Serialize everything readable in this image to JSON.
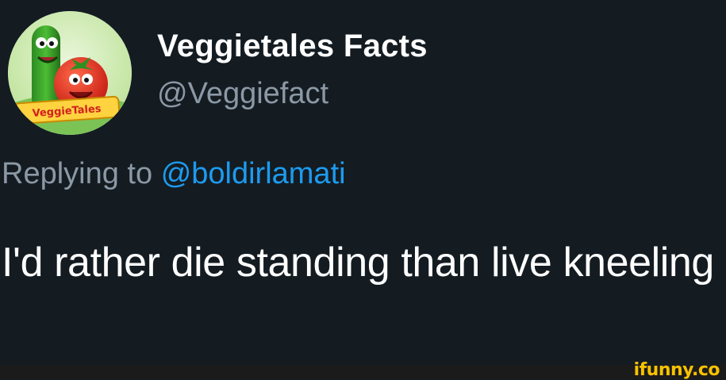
{
  "account": {
    "display_name": "Veggietales Facts",
    "handle": "@Veggiefact",
    "avatar_logo_text": "VeggieTales"
  },
  "reply": {
    "prefix": "Replying to",
    "mention": "@boldirlamati"
  },
  "tweet": {
    "text": "I'd rather die standing than live kneeling"
  },
  "watermark": {
    "text": "ifunny.co"
  },
  "colors": {
    "background": "#141c22",
    "primary_text": "#ffffff",
    "secondary_text": "#8b98a5",
    "mention": "#1d9bf0",
    "watermark": "#f6c200"
  }
}
